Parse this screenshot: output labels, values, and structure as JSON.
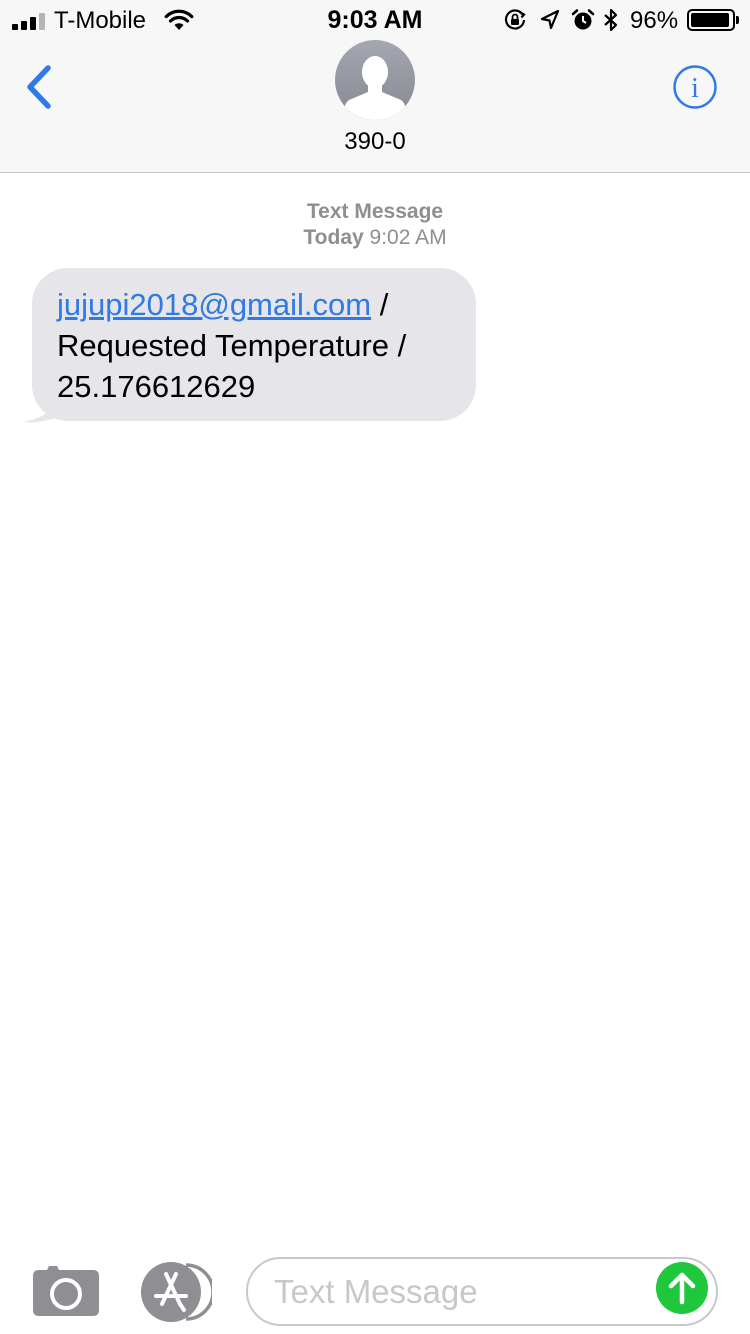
{
  "status_bar": {
    "carrier": "T-Mobile",
    "time": "9:03 AM",
    "battery_percent": "96%",
    "battery_level": 0.96,
    "icons": [
      "signal-icon",
      "wifi-icon",
      "orientation-lock-icon",
      "location-icon",
      "alarm-icon",
      "bluetooth-icon",
      "battery-icon"
    ]
  },
  "header": {
    "contact_name": "390-0",
    "back_icon": "chevron-left-icon",
    "avatar_icon": "person-silhouette-icon",
    "info_label": "i"
  },
  "conversation": {
    "service_label": "Text Message",
    "day_label": "Today",
    "time_label": "9:02 AM",
    "messages": [
      {
        "direction": "incoming",
        "link_text": "jujupi2018@gmail.com",
        "text_after_link": " /",
        "line2": "Requested Temperature /",
        "line3": "25.176612629"
      }
    ]
  },
  "input_bar": {
    "placeholder": "Text Message",
    "camera_icon": "camera-icon",
    "apps_icon": "app-store-icon",
    "send_icon": "send-arrow-icon"
  },
  "colors": {
    "accent": "#2f7ae5",
    "incoming_bubble": "#e5e5ea",
    "send_button": "#1ec73b",
    "meta_text": "#8e8e93",
    "header_bg": "#f7f7f7"
  }
}
